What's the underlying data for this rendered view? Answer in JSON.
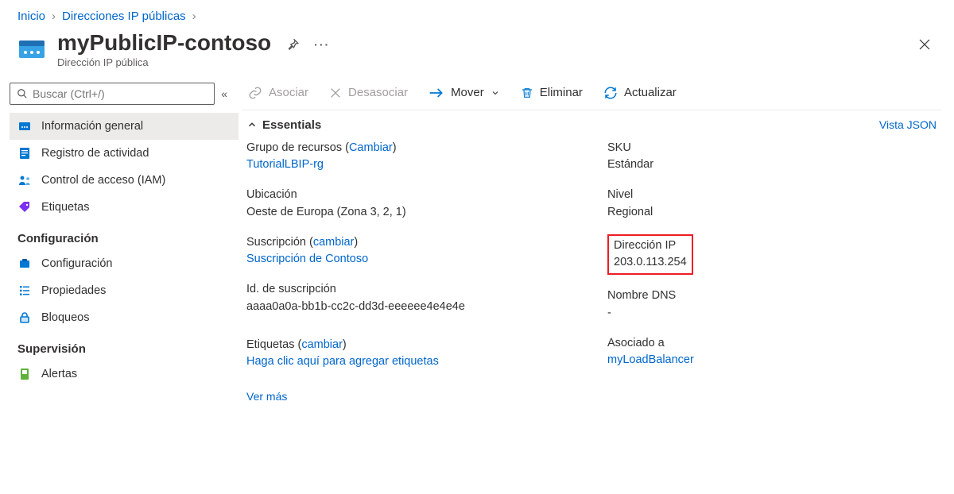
{
  "breadcrumb": {
    "home": "Inicio",
    "parent": "Direcciones IP públicas"
  },
  "header": {
    "title": "myPublicIP-contoso",
    "subtitle": "Dirección IP pública"
  },
  "search": {
    "placeholder": "Buscar (Ctrl+/)"
  },
  "sidebar": {
    "top": [
      {
        "label": "Información general",
        "icon": "resource"
      },
      {
        "label": "Registro de actividad",
        "icon": "log"
      },
      {
        "label": "Control de acceso (IAM)",
        "icon": "iam"
      },
      {
        "label": "Etiquetas",
        "icon": "tag"
      }
    ],
    "section_config_title": "Configuración",
    "config": [
      {
        "label": "Configuración",
        "icon": "config"
      },
      {
        "label": "Propiedades",
        "icon": "props"
      },
      {
        "label": "Bloqueos",
        "icon": "lock"
      }
    ],
    "section_monitor_title": "Supervisión",
    "monitor": [
      {
        "label": "Alertas",
        "icon": "alert"
      }
    ]
  },
  "toolbar": {
    "associate": "Asociar",
    "disassociate": "Desasociar",
    "move": "Mover",
    "delete": "Eliminar",
    "refresh": "Actualizar"
  },
  "essentials": {
    "title": "Essentials",
    "json_view": "Vista JSON",
    "left": {
      "resource_group_label": "Grupo de recursos",
      "resource_group_change": "Cambiar",
      "resource_group_value": "TutorialLBIP-rg",
      "location_label": "Ubicación",
      "location_value": "Oeste de Europa (Zona 3, 2, 1)",
      "subscription_label": "Suscripción",
      "subscription_change": "cambiar",
      "subscription_value": "Suscripción de Contoso",
      "subscription_id_label": "Id. de suscripción",
      "subscription_id_value": "aaaa0a0a-bb1b-cc2c-dd3d-eeeeee4e4e4e",
      "tags_label": "Etiquetas",
      "tags_change": "cambiar",
      "tags_value": "Haga clic aquí para agregar etiquetas"
    },
    "right": {
      "sku_label": "SKU",
      "sku_value": "Estándar",
      "tier_label": "Nivel",
      "tier_value": "Regional",
      "ip_label": "Dirección IP",
      "ip_value": "203.0.113.254",
      "dns_label": "Nombre DNS",
      "dns_value": "-",
      "assoc_label": "Asociado a",
      "assoc_value": "myLoadBalancer"
    },
    "see_more": "Ver más"
  }
}
